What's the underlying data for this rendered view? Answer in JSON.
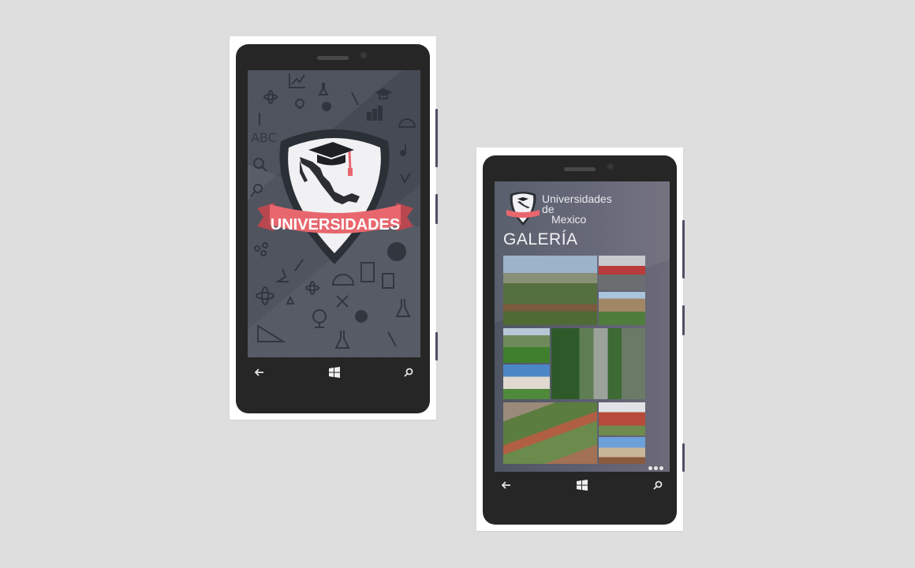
{
  "splash": {
    "banner_text": "UNIVERSIDADES",
    "doodles": [
      "ABC"
    ]
  },
  "gallery": {
    "brand_line1": "Universidades",
    "brand_line2": "de",
    "brand_line3": "Mexico",
    "title": "GALERÍA"
  },
  "icons": {
    "back": "back-arrow-icon",
    "start": "windows-logo-icon",
    "search": "search-icon",
    "more": "more-options-icon"
  },
  "colors": {
    "banner": "#e8676e",
    "banner_dark": "#b84750",
    "shield_border": "#2b2f36",
    "shield_fill": "#f1f1f3"
  }
}
